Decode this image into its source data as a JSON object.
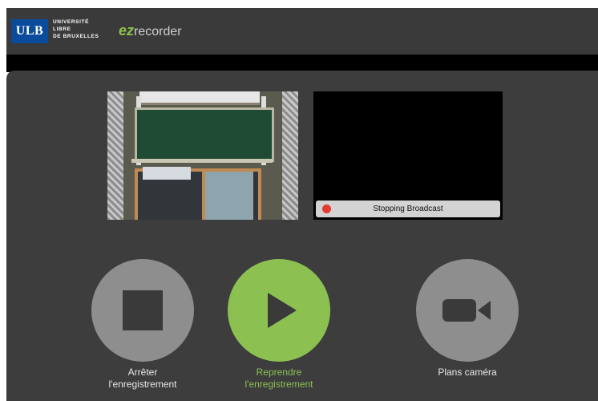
{
  "header": {
    "logo_abbr": "ULB",
    "logo_lines": [
      "UNIVERSITÉ",
      "LIBRE",
      "DE BRUXELLES"
    ],
    "app_mark": "ez",
    "app_name": "recorder"
  },
  "broadcast": {
    "status_text": "Stopping Broadcast"
  },
  "controls": {
    "stop_label": "Arrêter\nl'enregistrement",
    "resume_label": "Reprendre\nl'enregistrement",
    "camera_label": "Plans caméra"
  },
  "colors": {
    "accent_green": "#8cc152",
    "button_grey": "#8e8e8e",
    "panel_bg": "#3d3d3d",
    "ulb_blue": "#0a4b9b",
    "status_dot": "#e53a2f"
  },
  "icons": {
    "stop": "stop-square-icon",
    "play": "play-triangle-icon",
    "camera": "video-camera-icon",
    "status": "red-dot-icon"
  }
}
